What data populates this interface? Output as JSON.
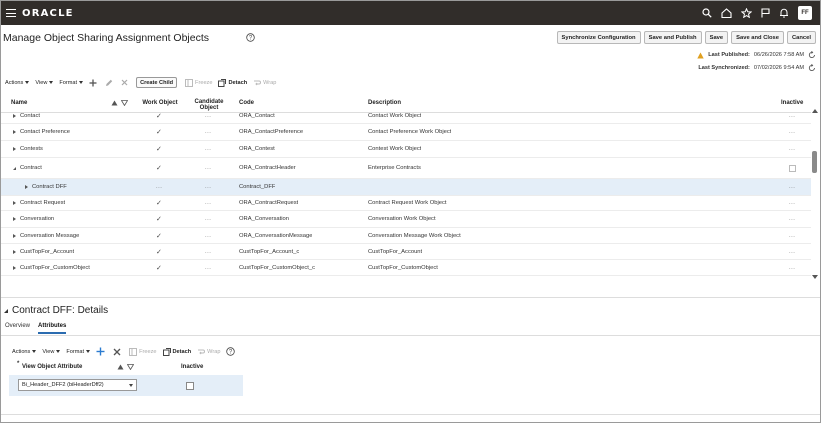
{
  "app": {
    "brand": "ORACLE",
    "user_initials": "FF"
  },
  "header": {
    "title": "Manage Object Sharing Assignment Objects",
    "buttons": [
      "Synchronize Configuration",
      "Save and Publish",
      "Save",
      "Save and Close",
      "Cancel"
    ],
    "last_published_label": "Last Published:",
    "last_published_value": "06/26/2026 7:58 AM",
    "last_synchronized_label": "Last Synchronized:",
    "last_synchronized_value": "07/02/2026 9:54 AM"
  },
  "toolbar": {
    "actions": "Actions",
    "view": "View",
    "format": "Format",
    "create_child": "Create Child",
    "freeze": "Freeze",
    "detach": "Detach",
    "wrap": "Wrap"
  },
  "table": {
    "columns": {
      "name": "Name",
      "work_object": "Work Object",
      "candidate_object": "Candidate Object",
      "code": "Code",
      "description": "Description",
      "inactive": "Inactive"
    },
    "rows": [
      {
        "name": "Contact",
        "work": "✓",
        "candidate": "...",
        "code": "ORA_Contact",
        "description": "Contact Work Object",
        "inactive": "...",
        "state": "collapsed",
        "level": 0
      },
      {
        "name": "Contact Preference",
        "work": "✓",
        "candidate": "...",
        "code": "ORA_ContactPreference",
        "description": "Contact Preference Work Object",
        "inactive": "...",
        "state": "collapsed",
        "level": 0
      },
      {
        "name": "Contests",
        "work": "✓",
        "candidate": "...",
        "code": "ORA_Contest",
        "description": "Contest Work Object",
        "inactive": "...",
        "state": "collapsed",
        "level": 0
      },
      {
        "name": "Contract",
        "work": "✓",
        "candidate": "...",
        "code": "ORA_ContractHeader",
        "description": "Enterprise Contracts",
        "inactive": "",
        "state": "expanded",
        "level": 0
      },
      {
        "name": "Contract DFF",
        "work": "...",
        "candidate": "...",
        "code": "Contract_DFF",
        "description": "",
        "inactive": "...",
        "state": "collapsed",
        "level": 1,
        "selected": true
      },
      {
        "name": "Contract Request",
        "work": "✓",
        "candidate": "...",
        "code": "ORA_ContractRequest",
        "description": "Contract Request Work Object",
        "inactive": "...",
        "state": "collapsed",
        "level": 0
      },
      {
        "name": "Conversation",
        "work": "✓",
        "candidate": "...",
        "code": "ORA_Conversation",
        "description": "Conversation Work Object",
        "inactive": "...",
        "state": "collapsed",
        "level": 0
      },
      {
        "name": "Conversation Message",
        "work": "✓",
        "candidate": "...",
        "code": "ORA_ConversationMessage",
        "description": "Conversation Message Work Object",
        "inactive": "...",
        "state": "collapsed",
        "level": 0
      },
      {
        "name": "CustTopFor_Account",
        "work": "✓",
        "candidate": "...",
        "code": "CustTopFor_Account_c",
        "description": "CustTopFor_Account",
        "inactive": "...",
        "state": "collapsed",
        "level": 0
      },
      {
        "name": "CustTopFor_CustomObject",
        "work": "✓",
        "candidate": "...",
        "code": "CustTopFor_CustomObject_c",
        "description": "CustTopFor_CustomObject",
        "inactive": "...",
        "state": "collapsed",
        "level": 0
      }
    ]
  },
  "details": {
    "title": "Contract DFF: Details",
    "tabs": [
      "Overview",
      "Attributes"
    ],
    "active_tab": "Attributes",
    "toolbar": {
      "actions": "Actions",
      "view": "View",
      "format": "Format",
      "freeze": "Freeze",
      "detach": "Detach",
      "wrap": "Wrap"
    },
    "columns": {
      "required_marker": "*",
      "view_object_attribute": "View Object Attribute",
      "inactive": "Inactive"
    },
    "row": {
      "attribute_value": "Bi_Header_DFF2 (biHeaderDff2)"
    }
  }
}
